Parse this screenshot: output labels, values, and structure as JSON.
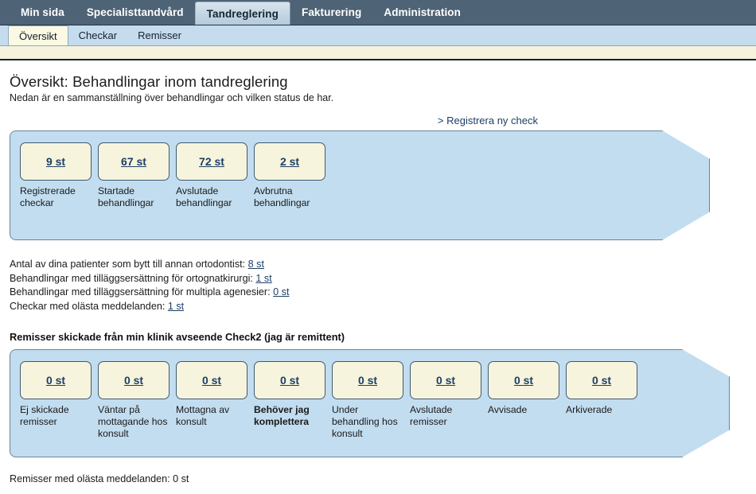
{
  "topnav": {
    "items": [
      {
        "label": "Min sida",
        "active": false
      },
      {
        "label": "Specialisttandvård",
        "active": false
      },
      {
        "label": "Tandreglering",
        "active": true
      },
      {
        "label": "Fakturering",
        "active": false
      },
      {
        "label": "Administration",
        "active": false
      }
    ]
  },
  "subnav": {
    "items": [
      {
        "label": "Översikt",
        "active": true
      },
      {
        "label": "Checkar",
        "active": false
      },
      {
        "label": "Remisser",
        "active": false
      }
    ]
  },
  "page": {
    "title": "Översikt: Behandlingar inom tandreglering",
    "subtitle": "Nedan är en sammanställning över behandlingar och vilken status de har.",
    "register_link": "> Registrera ny check"
  },
  "treatments_panel": {
    "boxes": [
      {
        "count": "9 st",
        "label": "Registrerade checkar",
        "bold": false
      },
      {
        "count": "67 st",
        "label": "Startade behandlingar",
        "bold": false
      },
      {
        "count": "72 st",
        "label": "Avslutade behandlingar",
        "bold": false
      },
      {
        "count": "2 st",
        "label": "Avbrutna behandlingar",
        "bold": false
      }
    ]
  },
  "stats": [
    {
      "text": "Antal av dina patienter som bytt till annan ortodontist:",
      "value": "8 st"
    },
    {
      "text": "Behandlingar med tilläggsersättning för ortognatkirurgi:",
      "value": "1 st"
    },
    {
      "text": "Behandlingar med tilläggsersättning för multipla agenesier:",
      "value": "0 st"
    },
    {
      "text": "Checkar med olästa meddelanden:",
      "value": "1 st"
    }
  ],
  "referrals": {
    "heading": "Remisser skickade från min klinik avseende Check2 (jag är remittent)",
    "boxes": [
      {
        "count": "0 st",
        "label": "Ej skickade remisser",
        "bold": false
      },
      {
        "count": "0 st",
        "label": "Väntar på mottagande hos konsult",
        "bold": false
      },
      {
        "count": "0 st",
        "label": "Mottagna av konsult",
        "bold": false
      },
      {
        "count": "0 st",
        "label": "Behöver jag komplettera",
        "bold": true
      },
      {
        "count": "0 st",
        "label": "Under behandling hos konsult",
        "bold": false
      },
      {
        "count": "0 st",
        "label": "Avslutade remisser",
        "bold": false
      },
      {
        "count": "0 st",
        "label": "Avvisade",
        "bold": false
      },
      {
        "count": "0 st",
        "label": "Arkiverade",
        "bold": false
      }
    ],
    "footnote": "Remisser med olästa meddelanden: 0 st"
  },
  "colors": {
    "header_bg": "#4e6375",
    "subnav_bg": "#c5dcef",
    "panel_bg": "#c2ddf0",
    "box_bg": "#f7f4dd",
    "link": "#1d3f66",
    "cream_strip": "#f5f2dd"
  }
}
